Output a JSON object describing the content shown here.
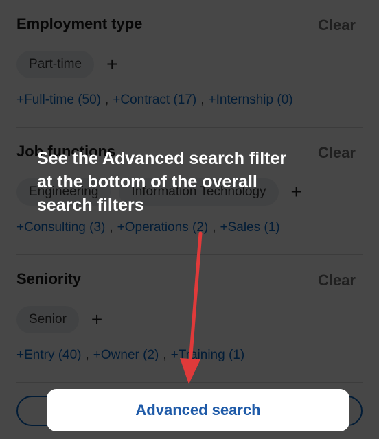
{
  "employment_type": {
    "title": "Employment type",
    "clear_label": "Clear",
    "selected": [
      "Part-time"
    ],
    "suggestions": [
      "+Full-time (50)",
      "+Contract (17)",
      "+Internship (0)"
    ]
  },
  "job_functions": {
    "title": "Job functions",
    "clear_label": "Clear",
    "selected": [
      "Engineering",
      "Information Technology"
    ],
    "suggestions": [
      "+Consulting (3)",
      "+Operations (2)",
      "+Sales (1)"
    ]
  },
  "seniority": {
    "title": "Seniority",
    "clear_label": "Clear",
    "selected": [
      "Senior"
    ],
    "suggestions": [
      "+Entry (40)",
      "+Owner (2)",
      "+Training (1)"
    ]
  },
  "add_icon": "plus-icon",
  "separator": ",",
  "callout": {
    "text": "See the Advanced search filter at the bottom of the overall search filters",
    "arrow_color": "#e03a3a"
  },
  "advanced_search": {
    "label": "Advanced search"
  },
  "colors": {
    "link": "#0a66c2",
    "chip_bg": "#e9ecef",
    "overlay": "rgba(0,0,0,0.72)"
  }
}
